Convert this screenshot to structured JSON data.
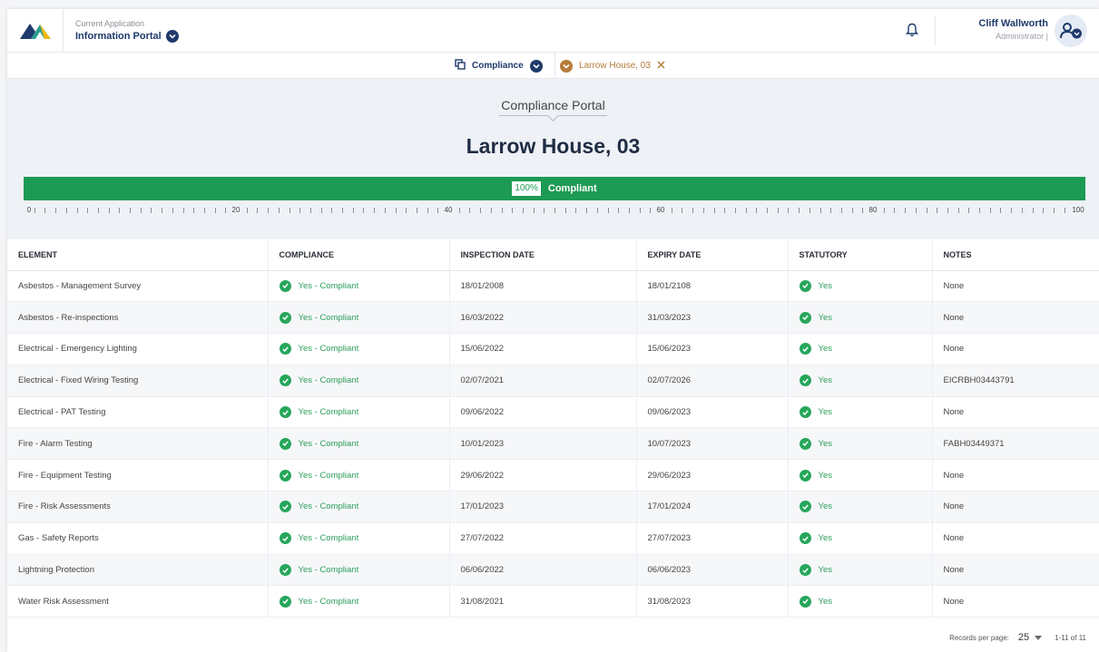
{
  "header": {
    "app_caption": "Current Application",
    "app_name": "Information Portal",
    "user_name": "Cliff Wallworth",
    "user_role": "Administrator |"
  },
  "tabs": {
    "compliance_label": "Compliance",
    "property_label": "Larrow House, 03"
  },
  "hero": {
    "portal_label": "Compliance Portal",
    "property_title": "Larrow House, 03",
    "progress_value": 100,
    "progress_percent": "100%",
    "progress_status": "Compliant",
    "scale_labels": [
      "0",
      "20",
      "40",
      "60",
      "80",
      "100"
    ]
  },
  "table": {
    "headers": [
      "ELEMENT",
      "COMPLIANCE",
      "INSPECTION DATE",
      "EXPIRY DATE",
      "STATUTORY",
      "NOTES"
    ],
    "rows": [
      {
        "element": "Asbestos - Management Survey",
        "compliance": "Yes - Compliant",
        "inspection": "18/01/2008",
        "expiry": "18/01/2108",
        "statutory": "Yes",
        "notes": "None"
      },
      {
        "element": "Asbestos - Re-inspections",
        "compliance": "Yes - Compliant",
        "inspection": "16/03/2022",
        "expiry": "31/03/2023",
        "statutory": "Yes",
        "notes": "None"
      },
      {
        "element": "Electrical - Emergency Lighting",
        "compliance": "Yes - Compliant",
        "inspection": "15/06/2022",
        "expiry": "15/06/2023",
        "statutory": "Yes",
        "notes": "None"
      },
      {
        "element": "Electrical - Fixed Wiring Testing",
        "compliance": "Yes - Compliant",
        "inspection": "02/07/2021",
        "expiry": "02/07/2026",
        "statutory": "Yes",
        "notes": "EICRBH03443791"
      },
      {
        "element": "Electrical - PAT Testing",
        "compliance": "Yes - Compliant",
        "inspection": "09/06/2022",
        "expiry": "09/06/2023",
        "statutory": "Yes",
        "notes": "None"
      },
      {
        "element": "Fire - Alarm Testing",
        "compliance": "Yes - Compliant",
        "inspection": "10/01/2023",
        "expiry": "10/07/2023",
        "statutory": "Yes",
        "notes": "FABH03449371"
      },
      {
        "element": "Fire - Equipment Testing",
        "compliance": "Yes - Compliant",
        "inspection": "29/06/2022",
        "expiry": "29/06/2023",
        "statutory": "Yes",
        "notes": "None"
      },
      {
        "element": "Fire - Risk Assessments",
        "compliance": "Yes - Compliant",
        "inspection": "17/01/2023",
        "expiry": "17/01/2024",
        "statutory": "Yes",
        "notes": "None"
      },
      {
        "element": "Gas - Safety Reports",
        "compliance": "Yes - Compliant",
        "inspection": "27/07/2022",
        "expiry": "27/07/2023",
        "statutory": "Yes",
        "notes": "None"
      },
      {
        "element": "Lightning Protection",
        "compliance": "Yes - Compliant",
        "inspection": "06/06/2022",
        "expiry": "06/06/2023",
        "statutory": "Yes",
        "notes": "None"
      },
      {
        "element": "Water Risk Assessment",
        "compliance": "Yes - Compliant",
        "inspection": "31/08/2021",
        "expiry": "31/08/2023",
        "statutory": "Yes",
        "notes": "None"
      }
    ]
  },
  "pagination": {
    "records_label": "Records per page:",
    "per_page": "25",
    "range": "1-11 of 11"
  },
  "colors": {
    "primary": "#1f3a6b",
    "accent_orange": "#b57d3a",
    "success": "#1d9a53"
  },
  "icons": [
    "logo-icon",
    "chevron-down-icon",
    "bell-icon",
    "user-settings-icon",
    "copy-icon",
    "close-icon",
    "check-circle-icon"
  ]
}
